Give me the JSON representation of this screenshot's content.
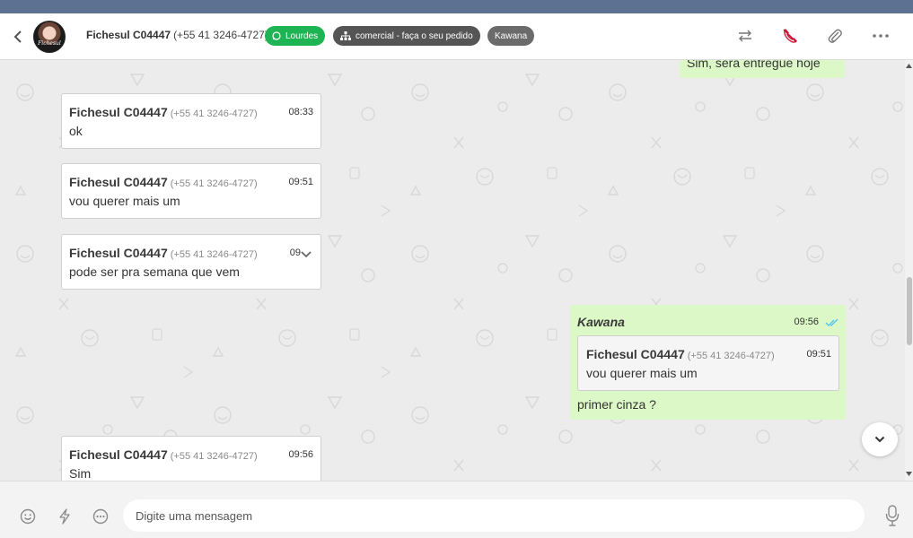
{
  "header": {
    "back_icon": "chevron-left-icon",
    "avatar_text": "Fichesul",
    "contact_name": "Fichesul C04447",
    "contact_phone": "(+55 41 3246-4727)",
    "tags": {
      "agent": "Lourdes",
      "queue": "comercial - faça o seu pedido",
      "user": "Kawana"
    },
    "colors": {
      "agent_tag": "#1fb453",
      "queue_tag": "#555555",
      "user_tag": "#6b6b6b",
      "topbar": "#5d7192",
      "end_call": "#c8102e"
    },
    "actions": [
      "transfer-icon",
      "end-call-icon",
      "paperclip-icon",
      "more-icon"
    ]
  },
  "messages": [
    {
      "direction": "out",
      "text": "Sim, sera entregue hoje"
    },
    {
      "direction": "in",
      "sender": "Fichesul C04447",
      "phone": "(+55 41 3246-4727)",
      "time": "08:33",
      "text": "ok"
    },
    {
      "direction": "in",
      "sender": "Fichesul C04447",
      "phone": "(+55 41 3246-4727)",
      "time": "09:51",
      "text": "vou querer mais um"
    },
    {
      "direction": "in",
      "sender": "Fichesul C04447",
      "phone": "(+55 41 3246-4727)",
      "time": "09",
      "text": "pode ser pra semana que vem"
    },
    {
      "direction": "out",
      "sender": "Kawana",
      "time": "09:56",
      "status": "read",
      "quoted": {
        "sender": "Fichesul C04447",
        "phone": "(+55 41 3246-4727)",
        "time": "09:51",
        "text": "vou querer mais um"
      },
      "text": "primer cinza ?"
    },
    {
      "direction": "in",
      "sender": "Fichesul C04447",
      "phone": "(+55 41 3246-4727)",
      "time": "09:56",
      "text": "Sim"
    }
  ],
  "composer": {
    "placeholder": "Digite uma mensagem",
    "value": "",
    "left_icons": [
      "emoji-icon",
      "lightning-icon",
      "quick-replies-icon"
    ],
    "mic_icon": "microphone-icon"
  },
  "colors": {
    "chat_bg": "#ececec",
    "outgoing_bubble": "#dcf8c6",
    "incoming_bubble": "#ffffff",
    "read_ticks": "#4fc3f7"
  }
}
